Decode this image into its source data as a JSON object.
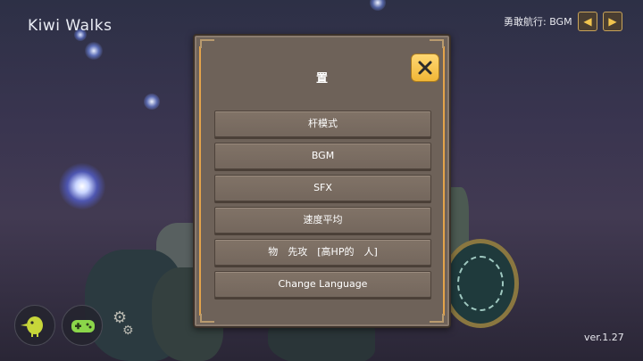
{
  "app": {
    "title": "Kiwi Walks"
  },
  "status": {
    "bgm_now_playing": "勇敢航行: BGM"
  },
  "icons": {
    "prev": "triangle-left-icon",
    "next": "triangle-right-icon",
    "close": "close-x-icon",
    "kiwi": "kiwi-bird-icon",
    "gamepad": "gamepad-icon",
    "gear": "gear-icon"
  },
  "dialog": {
    "title": "置",
    "menu": [
      {
        "label": "杆模式"
      },
      {
        "label": "BGM"
      },
      {
        "label": "SFX"
      },
      {
        "label": "速度平均"
      },
      {
        "label": "物　先攻　[高HP的　人]"
      },
      {
        "label": "Change Language"
      }
    ]
  },
  "version": "ver.1.27",
  "colors": {
    "accent": "#F2BE45",
    "panel": "#6E6259",
    "button": "#7A6D62",
    "kiwi_green": "#C7D63A"
  }
}
